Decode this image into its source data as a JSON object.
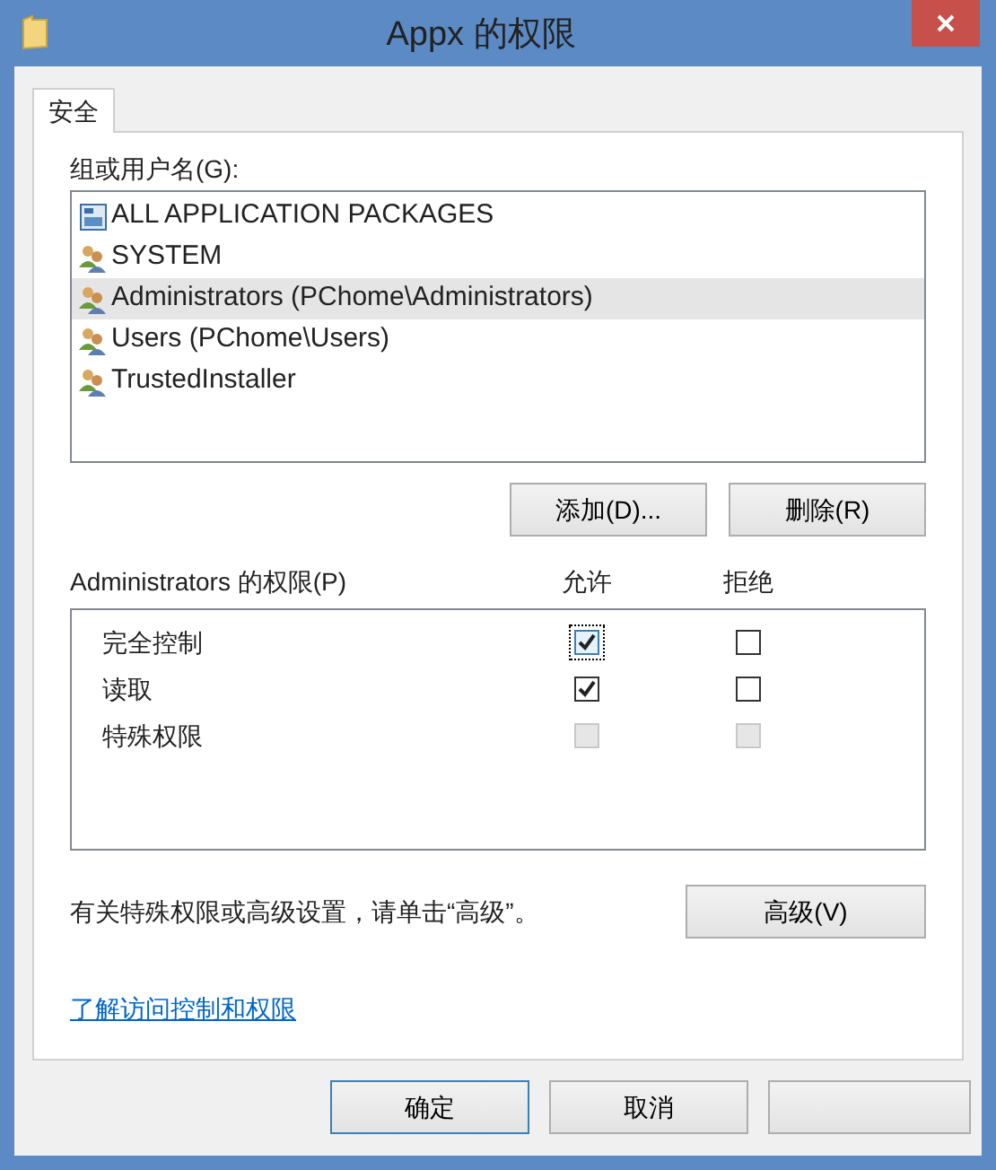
{
  "window": {
    "title": "Appx 的权限"
  },
  "tabs": [
    {
      "label": "安全",
      "selected": true
    }
  ],
  "users": {
    "label": "组或用户名(G):",
    "items": [
      {
        "name": "ALL APPLICATION PACKAGES",
        "kind": "package",
        "selected": false
      },
      {
        "name": "SYSTEM",
        "kind": "group",
        "selected": false
      },
      {
        "name": "Administrators (PChome\\Administrators)",
        "kind": "group",
        "selected": true
      },
      {
        "name": "Users (PChome\\Users)",
        "kind": "group",
        "selected": false
      },
      {
        "name": "TrustedInstaller",
        "kind": "group",
        "selected": false
      }
    ],
    "buttons": [
      "添加(D)...",
      "删除(R)"
    ]
  },
  "permissions": {
    "label": "Administrators 的权限(P)",
    "columns": [
      "允许",
      "拒绝"
    ],
    "rows": [
      {
        "name": "完全控制",
        "allow": {
          "checked": true,
          "disabled": false,
          "focused": true
        },
        "deny": {
          "checked": false,
          "disabled": false,
          "focused": false
        }
      },
      {
        "name": "读取",
        "allow": {
          "checked": true,
          "disabled": false,
          "focused": false
        },
        "deny": {
          "checked": false,
          "disabled": false,
          "focused": false
        }
      },
      {
        "name": "特殊权限",
        "allow": {
          "checked": false,
          "disabled": true,
          "focused": false
        },
        "deny": {
          "checked": false,
          "disabled": true,
          "focused": false
        }
      }
    ]
  },
  "advanced": {
    "note": "有关特殊权限或高级设置，请单击“高级”。",
    "button": "高级(V)"
  },
  "link": "了解访问控制和权限",
  "footer_buttons": [
    {
      "label": "确定",
      "default": true
    },
    {
      "label": "取消",
      "default": false
    }
  ]
}
